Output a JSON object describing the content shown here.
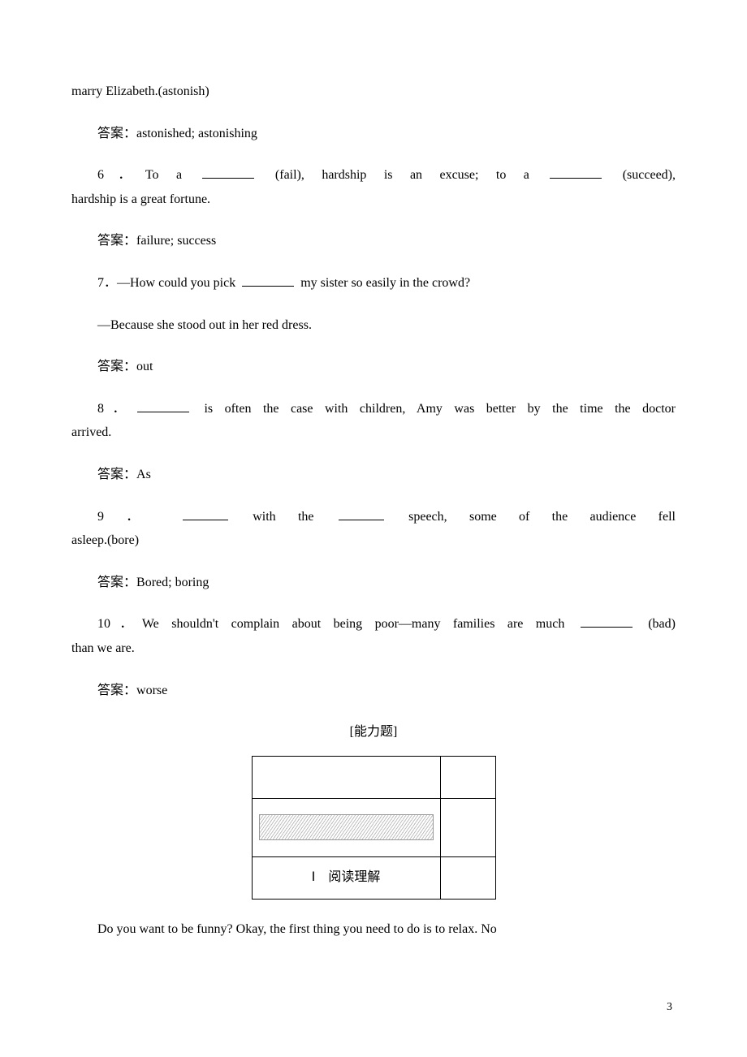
{
  "top_fragment": "marry Elizabeth.(astonish)",
  "answer_label": "答案：",
  "q5_answer": "astonished; astonishing",
  "q6_part1": "6．To a ",
  "q6_hint1": " (fail), hardship is an excuse; to a ",
  "q6_hint2": " (succeed),",
  "q6_line2": "hardship is a great fortune.",
  "q6_answer": "failure; success",
  "q7_text_a": "7．—How could you pick ",
  "q7_text_b": " my sister so easily in the crowd?",
  "q7_line2": "—Because she stood out in her red dress.",
  "q7_answer": "out",
  "q8_text_a": "8．",
  "q8_text_b": " is often the case with children, Amy was better by the time the doctor",
  "q8_line2": "arrived.",
  "q8_answer": "As",
  "q9_text_a": "9 ． ",
  "q9_text_b": "  with the ",
  "q9_text_c": "  speech, some of the audience fell",
  "q9_line2": "asleep.(bore)",
  "q9_answer": "Bored; boring",
  "q10_text_a": "10．We shouldn't complain about being poor—many families are much ",
  "q10_text_b": " (bad)",
  "q10_line2": "than we are.",
  "q10_answer": "worse",
  "section_title": "[能力题]",
  "table_label": "Ⅰ　阅读理解",
  "closing_text": "Do you want to be funny? Okay, the first thing you need to do is to relax. No",
  "page_number": "3"
}
